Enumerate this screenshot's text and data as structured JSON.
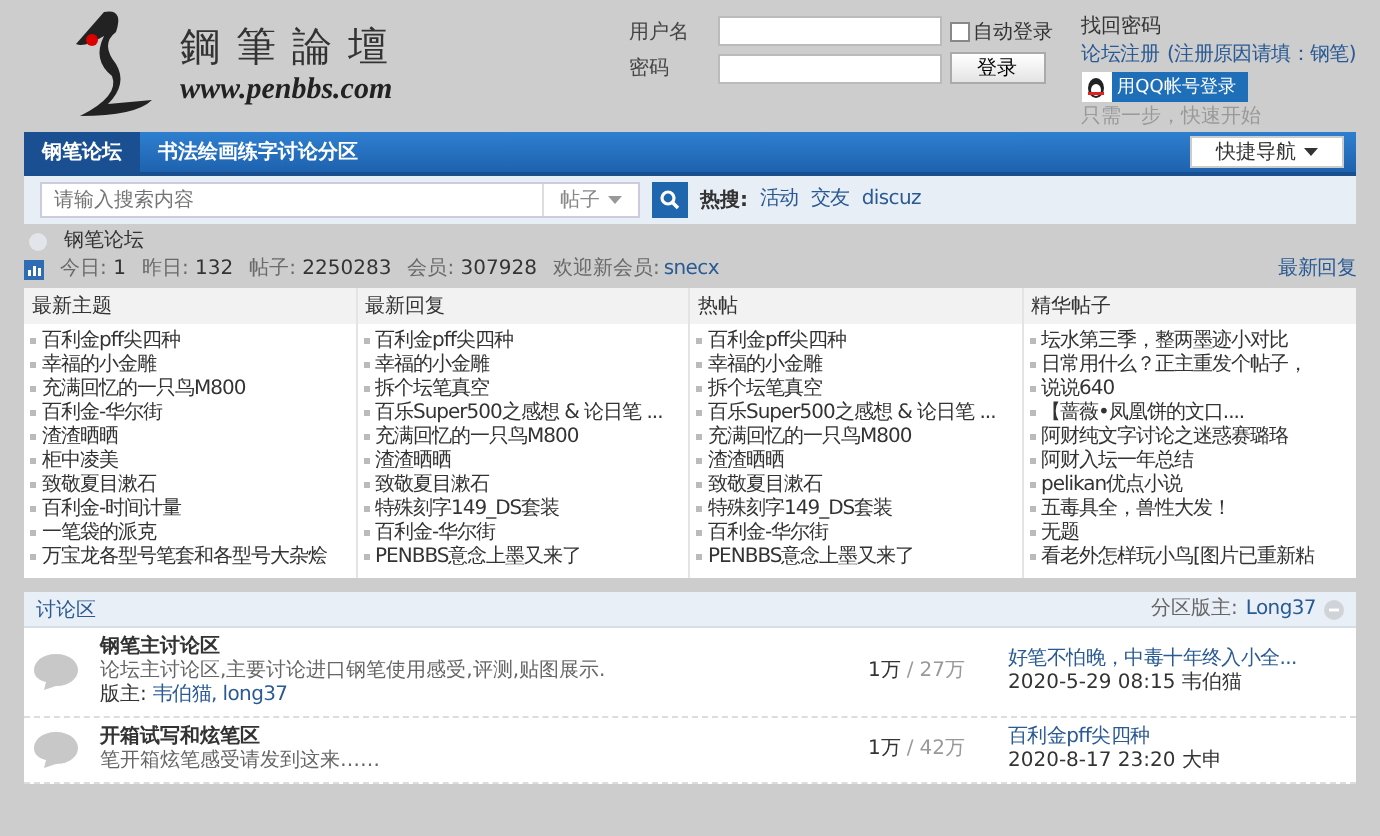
{
  "site": {
    "name": "鋼筆論壇",
    "url": "www.penbbs.com"
  },
  "login": {
    "username_label": "用户名",
    "password_label": "密码",
    "auto_login": {
      "label": "自动登录",
      "checked": false
    },
    "login_button": "登录",
    "forgot": "找回密码",
    "register": "论坛注册",
    "register_note": "(注册原因请填：钢笔)",
    "qq_button": "用QQ帐号登录",
    "qq_hint": "只需一步，快速开始"
  },
  "nav": {
    "tabs": [
      {
        "label": "钢笔论坛",
        "selected": true
      },
      {
        "label": "书法绘画练字讨论分区",
        "selected": false
      }
    ],
    "quick_nav": "快捷导航"
  },
  "search": {
    "placeholder": "请输入搜索内容",
    "scope": "帖子",
    "hot_label": "热搜:",
    "hot": [
      "活动",
      "交友",
      "discuz"
    ]
  },
  "breadcrumb": "钢笔论坛",
  "stats": [
    {
      "label": "今日:",
      "value": "1"
    },
    {
      "label": "昨日:",
      "value": "132"
    },
    {
      "label": "帖子:",
      "value": "2250283"
    },
    {
      "label": "会员:",
      "value": "307928"
    }
  ],
  "welcome": {
    "label": "欢迎新会员:",
    "user": "snecx"
  },
  "latest_link": "最新回复",
  "columns": [
    {
      "title": "最新主题",
      "items": [
        "百利金pff尖四种",
        "幸福的小金雕",
        "充满回忆的一只鸟M800",
        "百利金-华尔街",
        "渣渣晒晒",
        "柜中凌美",
        "致敬夏目漱石",
        "百利金-时间计量",
        "一笔袋的派克",
        "万宝龙各型号笔套和各型号大杂烩"
      ]
    },
    {
      "title": "最新回复",
      "items": [
        "百利金pff尖四种",
        "幸福的小金雕",
        "拆个坛笔真空",
        "百乐Super500之感想 & 论日笔 ...",
        "充满回忆的一只鸟M800",
        "渣渣晒晒",
        "致敬夏目漱石",
        "特殊刻字149_DS套装",
        "百利金-华尔街",
        "PENBBS意念上墨又来了"
      ]
    },
    {
      "title": "热帖",
      "items": [
        "百利金pff尖四种",
        "幸福的小金雕",
        "拆个坛笔真空",
        "百乐Super500之感想 & 论日笔 ...",
        "充满回忆的一只鸟M800",
        "渣渣晒晒",
        "致敬夏目漱石",
        "特殊刻字149_DS套装",
        "百利金-华尔街",
        "PENBBS意念上墨又来了"
      ]
    },
    {
      "title": "精华帖子",
      "items": [
        "坛水第三季，整两墨迹小对比",
        "日常用什么？正主重发个帖子，",
        "说说640",
        "【蔷薇•凤凰饼的文口....",
        "阿财纯文字讨论之迷惑赛璐珞",
        "阿财入坛一年总结",
        "pelikan优点小说",
        "五毒具全，兽性大发！",
        "无题",
        "看老外怎样玩小鸟[图片已重新粘"
      ]
    }
  ],
  "section": {
    "title": "讨论区",
    "moderator_label": "分区版主:",
    "moderator": "Long37",
    "expanded": true,
    "forums": [
      {
        "title": "钢笔主讨论区",
        "description": "论坛主讨论区,主要讨论进口钢笔使用感受,评测,贴图展示.",
        "mods_label": "版主:",
        "mods": "韦伯猫, long37",
        "threads": "1万",
        "separator": "/",
        "posts": "27万",
        "last_title": "好笔不怕晚，中毒十年终入小全...",
        "last_meta": "2020-5-29 08:15 韦伯猫"
      },
      {
        "title": "开箱试写和炫笔区",
        "description": "笔开箱炫笔感受请发到这来……",
        "threads": "1万",
        "separator": "/",
        "posts": "42万",
        "last_title": "百利金pff尖四种",
        "last_meta": "2020-8-17 23:20 大申"
      }
    ]
  }
}
